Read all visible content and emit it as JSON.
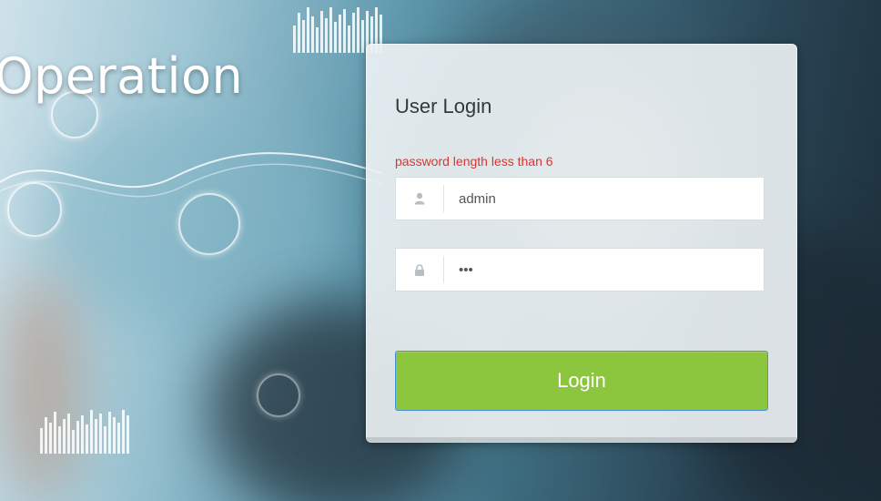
{
  "background": {
    "hero_title": "Operation"
  },
  "login": {
    "title": "User Login",
    "error": "password length less than 6",
    "username": {
      "value": "admin",
      "icon": "user-icon"
    },
    "password": {
      "value": "•••",
      "icon": "lock-icon"
    },
    "submit_label": "Login"
  },
  "colors": {
    "accent_green": "#8cc63f",
    "error_red": "#e0332f"
  }
}
